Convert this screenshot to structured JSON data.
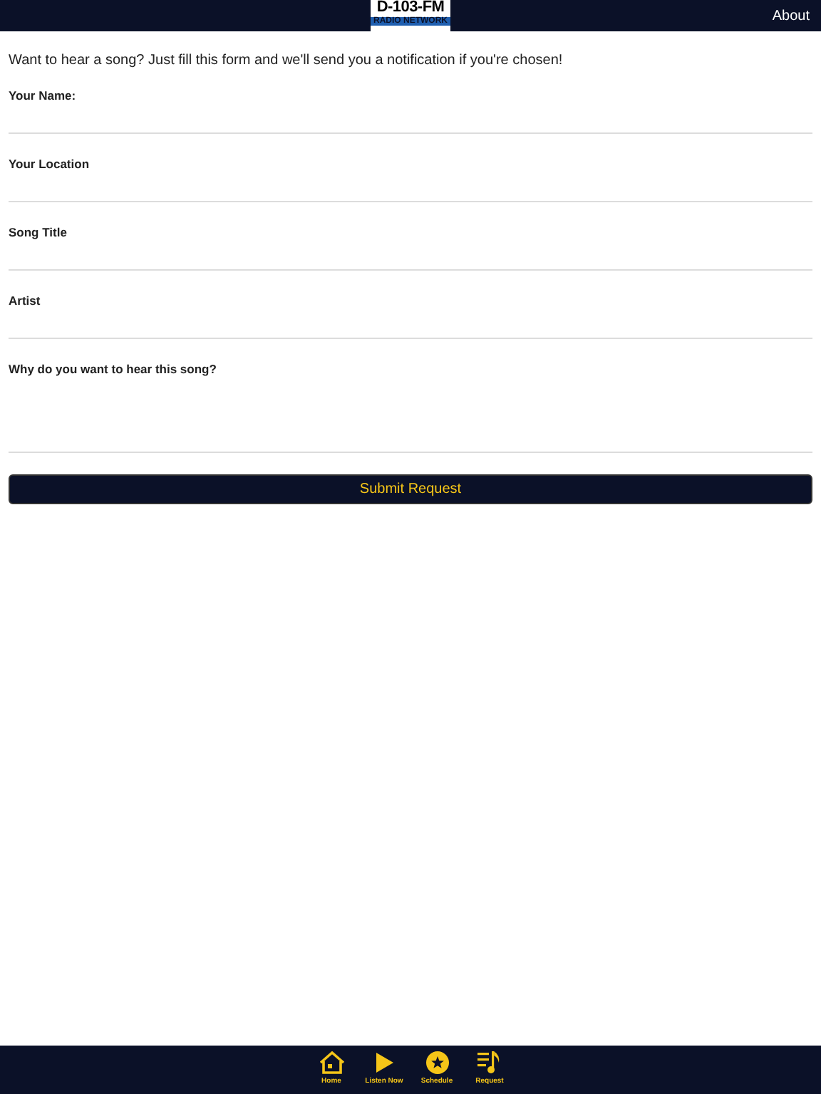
{
  "header": {
    "logo_title": "D-103-FM",
    "logo_subtitle": "RADIO NETWORK",
    "about": "About"
  },
  "intro": "Want to hear a song? Just fill this form and we'll send you a notification if you're chosen!",
  "fields": [
    {
      "label": "Your Name:",
      "kind": "line"
    },
    {
      "label": "Your Location",
      "kind": "line"
    },
    {
      "label": "Song Title",
      "kind": "line"
    },
    {
      "label": "Artist",
      "kind": "line"
    },
    {
      "label": "Why do you want to hear this song?",
      "kind": "area"
    }
  ],
  "submit": "Submit Request",
  "tabs": [
    {
      "label": "Home",
      "kind": "home"
    },
    {
      "label": "Listen Now",
      "kind": "play"
    },
    {
      "label": "Schedule",
      "kind": "star"
    },
    {
      "label": "Request",
      "kind": "request"
    }
  ]
}
